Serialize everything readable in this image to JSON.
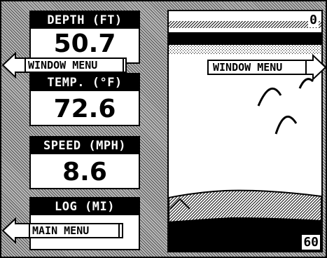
{
  "left_panels": [
    {
      "header": "DEPTH (FT)",
      "value": "50.7"
    },
    {
      "header": "TEMP. (°F)",
      "value": "72.6"
    },
    {
      "header": "SPEED (MPH)",
      "value": "8.6"
    },
    {
      "header": "LOG (MI)",
      "value": ""
    }
  ],
  "menus": {
    "window_menu_left": "WINDOW MENU",
    "window_menu_right": "WINDOW MENU",
    "main_menu": "MAIN MENU"
  },
  "sonar": {
    "depth_scale_top": "0",
    "depth_scale_bottom": "60"
  },
  "colors": {
    "foreground": "#000000",
    "background": "#ffffff",
    "hatch": "#b9b9b9"
  }
}
